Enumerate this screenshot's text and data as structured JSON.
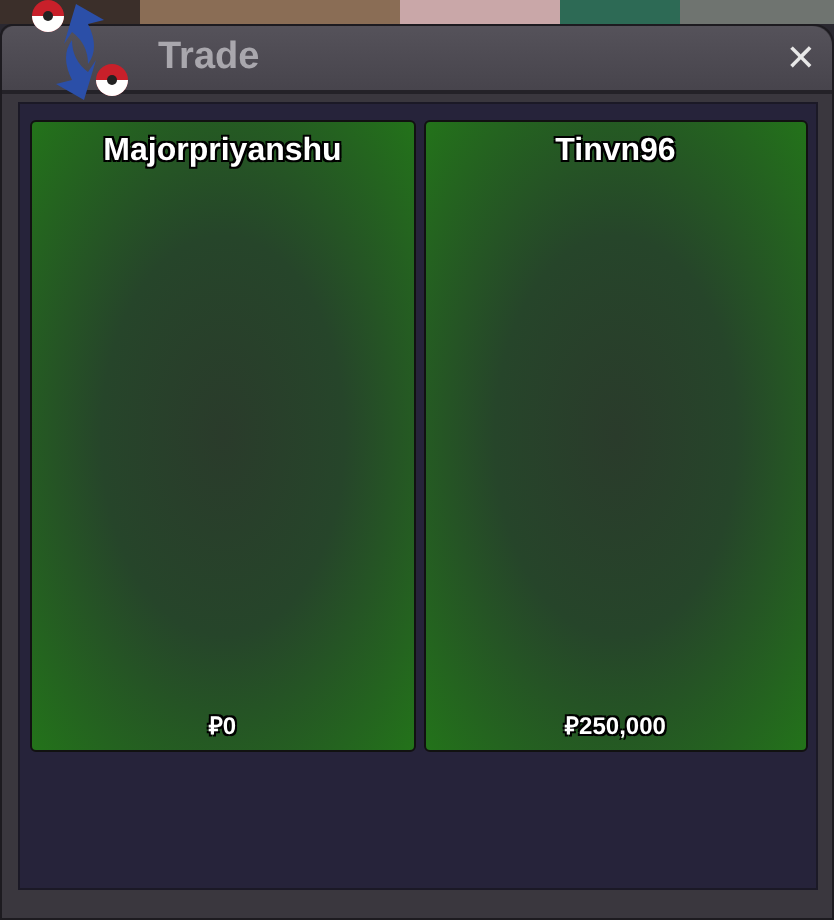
{
  "window": {
    "title": "Trade",
    "close": "✕"
  },
  "offers": [
    {
      "trainer": "Majorpriyanshu",
      "money": "₽0"
    },
    {
      "trainer": "Tinvn96",
      "money": "₽250,000"
    }
  ]
}
